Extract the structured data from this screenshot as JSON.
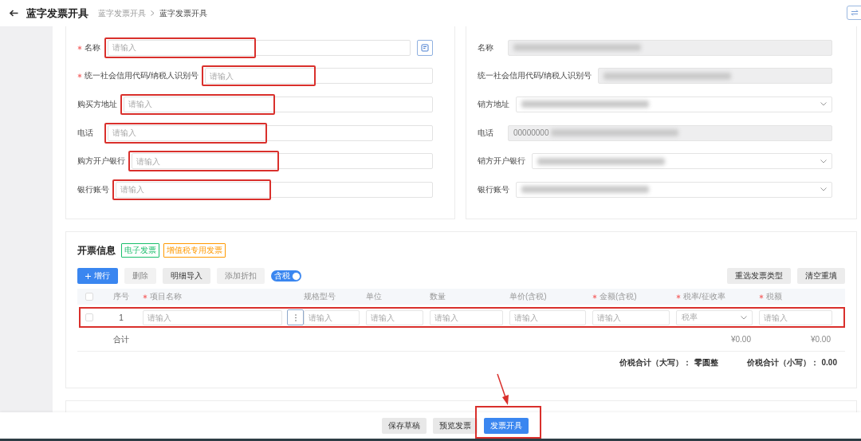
{
  "header": {
    "title": "蓝字发票开具",
    "breadcrumbs": [
      {
        "label": "蓝字发票开具",
        "selected": false
      },
      {
        "label": "蓝字发票开具",
        "selected": true
      }
    ]
  },
  "buyer": {
    "fields": [
      {
        "label": "名称",
        "required": true,
        "kind": "input-action",
        "placeholder": "请输入",
        "highlighted": true
      },
      {
        "label": "统一社会信用代码/纳税人识别号",
        "required": true,
        "kind": "input",
        "placeholder": "请输入",
        "highlighted": true
      },
      {
        "label": "购买方地址",
        "required": false,
        "kind": "input",
        "placeholder": "请输入",
        "highlighted": true
      },
      {
        "label": "电话",
        "required": false,
        "kind": "input",
        "placeholder": "请输入",
        "highlighted": true
      },
      {
        "label": "购方开户银行",
        "required": false,
        "kind": "input",
        "placeholder": "请输入",
        "highlighted": true
      },
      {
        "label": "银行账号",
        "required": false,
        "kind": "input",
        "placeholder": "请输入",
        "highlighted": true
      }
    ]
  },
  "seller": {
    "fields": [
      {
        "label": "名称",
        "kind": "readonly",
        "redacted": true
      },
      {
        "label": "统一社会信用代码/纳税人识别号",
        "kind": "readonly",
        "redacted": true
      },
      {
        "label": "销方地址",
        "kind": "select",
        "redacted": true
      },
      {
        "label": "电话",
        "kind": "readonly",
        "value": "00000000",
        "redacted": true
      },
      {
        "label": "销方开户银行",
        "kind": "select",
        "redacted": true
      },
      {
        "label": "银行账号",
        "kind": "select",
        "redacted": true
      }
    ]
  },
  "invoice": {
    "title": "开票信息",
    "tags": [
      {
        "label": "电子发票",
        "color": "#19be6b"
      },
      {
        "label": "增值税专用发票",
        "color": "#ff9900"
      }
    ],
    "toolbar": [
      {
        "label": "增行",
        "kind": "primary",
        "disabled": false
      },
      {
        "label": "删除",
        "kind": "default",
        "disabled": true
      },
      {
        "label": "明细导入",
        "kind": "default",
        "disabled": false
      },
      {
        "label": "添加折扣",
        "kind": "default",
        "disabled": true
      }
    ],
    "toggle": {
      "label": "含税",
      "on": true
    },
    "actions": [
      "重选发票类型",
      "清空重填"
    ],
    "table": {
      "header_checked": false,
      "columns": [
        {
          "label": "序号",
          "required": false
        },
        {
          "label": "项目名称",
          "required": true
        },
        {
          "label": "规格型号",
          "required": false
        },
        {
          "label": "单位",
          "required": false
        },
        {
          "label": "数量",
          "required": false
        },
        {
          "label": "单价(含税)",
          "required": false
        },
        {
          "label": "金额(含税)",
          "required": true
        },
        {
          "label": "税率/征收率",
          "required": true
        },
        {
          "label": "税额",
          "required": true
        }
      ],
      "rows": [
        {
          "checked": false,
          "highlighted": true,
          "cells": [
            {
              "kind": "text",
              "text": "1"
            },
            {
              "kind": "input-menu",
              "placeholder": "请输入"
            },
            {
              "kind": "input",
              "placeholder": "请输入"
            },
            {
              "kind": "input",
              "placeholder": "请输入"
            },
            {
              "kind": "input",
              "placeholder": "请输入"
            },
            {
              "kind": "input",
              "placeholder": "请输入"
            },
            {
              "kind": "input",
              "placeholder": "请输入"
            },
            {
              "kind": "select",
              "placeholder": "税率"
            },
            {
              "kind": "input",
              "placeholder": "请输入"
            }
          ]
        }
      ],
      "totals": {
        "label": "合计",
        "amount": "¥0.00",
        "tax": "¥0.00"
      }
    },
    "summary": [
      {
        "label": "价税合计（大写）：",
        "value": "零圆整"
      },
      {
        "label": "价税合计（小写）：",
        "value": "0.00"
      }
    ]
  },
  "footer": {
    "buttons": [
      {
        "label": "保存草稿",
        "primary": false,
        "highlighted": false
      },
      {
        "label": "预览发票",
        "primary": false,
        "highlighted": false
      },
      {
        "label": "发票开具",
        "primary": true,
        "highlighted": true
      }
    ]
  }
}
